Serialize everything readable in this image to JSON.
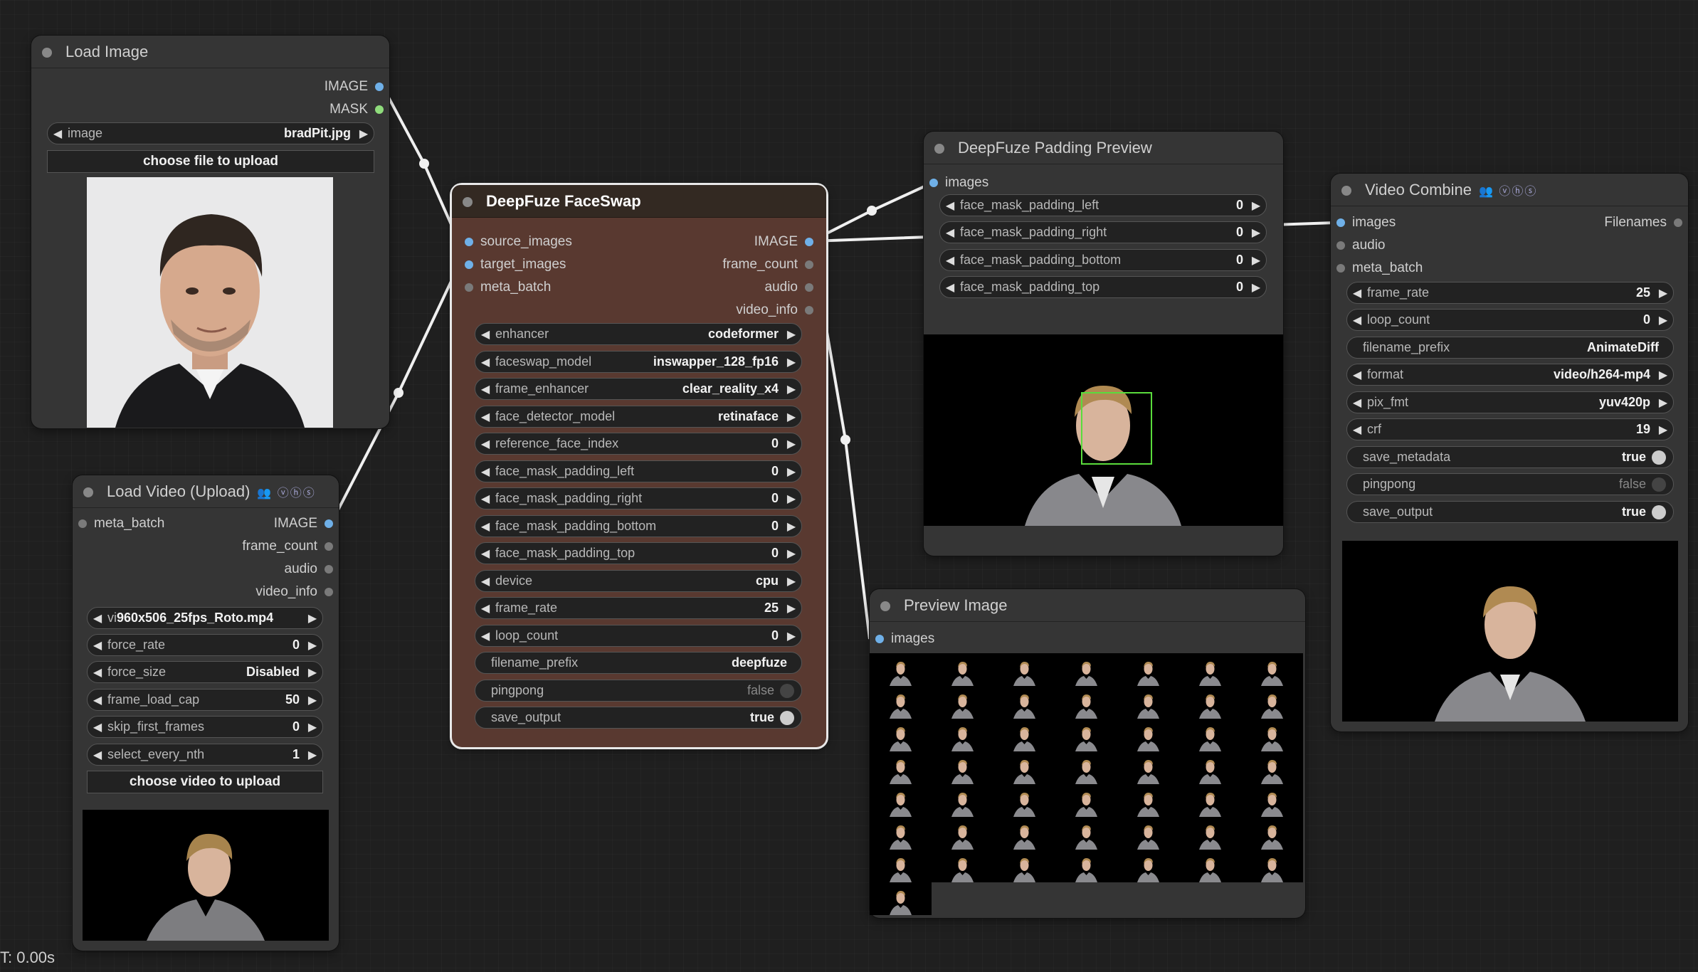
{
  "load_image": {
    "title": "Load Image",
    "outputs": [
      "IMAGE",
      "MASK"
    ],
    "image_widget": {
      "label": "image",
      "value": "bradPit.jpg"
    },
    "upload_button": "choose file to upload"
  },
  "load_video": {
    "title": "Load Video (Upload)",
    "badge": "👥 ⓥⓗⓢ",
    "inputs": [
      "meta_batch"
    ],
    "outputs": [
      "IMAGE",
      "frame_count",
      "audio",
      "video_info"
    ],
    "widgets": [
      {
        "label": "vi",
        "value": "960x506_25fps_Roto.mp4"
      },
      {
        "label": "force_rate",
        "value": "0"
      },
      {
        "label": "force_size",
        "value": "Disabled"
      },
      {
        "label": "frame_load_cap",
        "value": "50"
      },
      {
        "label": "skip_first_frames",
        "value": "0"
      },
      {
        "label": "select_every_nth",
        "value": "1"
      }
    ],
    "upload_button": "choose video to upload"
  },
  "faceswap": {
    "title": "DeepFuze FaceSwap",
    "inputs": [
      "source_images",
      "target_images",
      "meta_batch"
    ],
    "outputs": [
      "IMAGE",
      "frame_count",
      "audio",
      "video_info"
    ],
    "widgets": [
      {
        "label": "enhancer",
        "value": "codeformer"
      },
      {
        "label": "faceswap_model",
        "value": "inswapper_128_fp16"
      },
      {
        "label": "frame_enhancer",
        "value": "clear_reality_x4"
      },
      {
        "label": "face_detector_model",
        "value": "retinaface"
      },
      {
        "label": "reference_face_index",
        "value": "0"
      },
      {
        "label": "face_mask_padding_left",
        "value": "0"
      },
      {
        "label": "face_mask_padding_right",
        "value": "0"
      },
      {
        "label": "face_mask_padding_bottom",
        "value": "0"
      },
      {
        "label": "face_mask_padding_top",
        "value": "0"
      },
      {
        "label": "device",
        "value": "cpu"
      },
      {
        "label": "frame_rate",
        "value": "25"
      },
      {
        "label": "loop_count",
        "value": "0"
      }
    ],
    "text_widget": {
      "label": "filename_prefix",
      "value": "deepfuze"
    },
    "toggles": [
      {
        "label": "pingpong",
        "value": "false",
        "on": false
      },
      {
        "label": "save_output",
        "value": "true",
        "on": true
      }
    ]
  },
  "padding_preview": {
    "title": "DeepFuze Padding Preview",
    "inputs": [
      "images"
    ],
    "widgets": [
      {
        "label": "face_mask_padding_left",
        "value": "0"
      },
      {
        "label": "face_mask_padding_right",
        "value": "0"
      },
      {
        "label": "face_mask_padding_bottom",
        "value": "0"
      },
      {
        "label": "face_mask_padding_top",
        "value": "0"
      }
    ]
  },
  "preview_image": {
    "title": "Preview Image",
    "inputs": [
      "images"
    ],
    "frame_count": 50
  },
  "video_combine": {
    "title": "Video Combine",
    "badge": "👥 ⓥⓗⓢ",
    "inputs": [
      "images",
      "audio",
      "meta_batch"
    ],
    "outputs": [
      "Filenames"
    ],
    "widgets": [
      {
        "label": "frame_rate",
        "value": "25"
      },
      {
        "label": "loop_count",
        "value": "0"
      }
    ],
    "text_widget": {
      "label": "filename_prefix",
      "value": "AnimateDiff"
    },
    "widgets2": [
      {
        "label": "format",
        "value": "video/h264-mp4"
      },
      {
        "label": "pix_fmt",
        "value": "yuv420p"
      },
      {
        "label": "crf",
        "value": "19"
      }
    ],
    "toggles": [
      {
        "label": "save_metadata",
        "value": "true",
        "on": true
      },
      {
        "label": "pingpong",
        "value": "false",
        "on": false
      },
      {
        "label": "save_output",
        "value": "true",
        "on": true
      }
    ]
  },
  "status": "T: 0.00s",
  "colors": {
    "image_pin": "#6fb0e8",
    "mask_pin": "#8fdc7c",
    "faceswap_body": "#593930",
    "wire": "#ffffff"
  }
}
